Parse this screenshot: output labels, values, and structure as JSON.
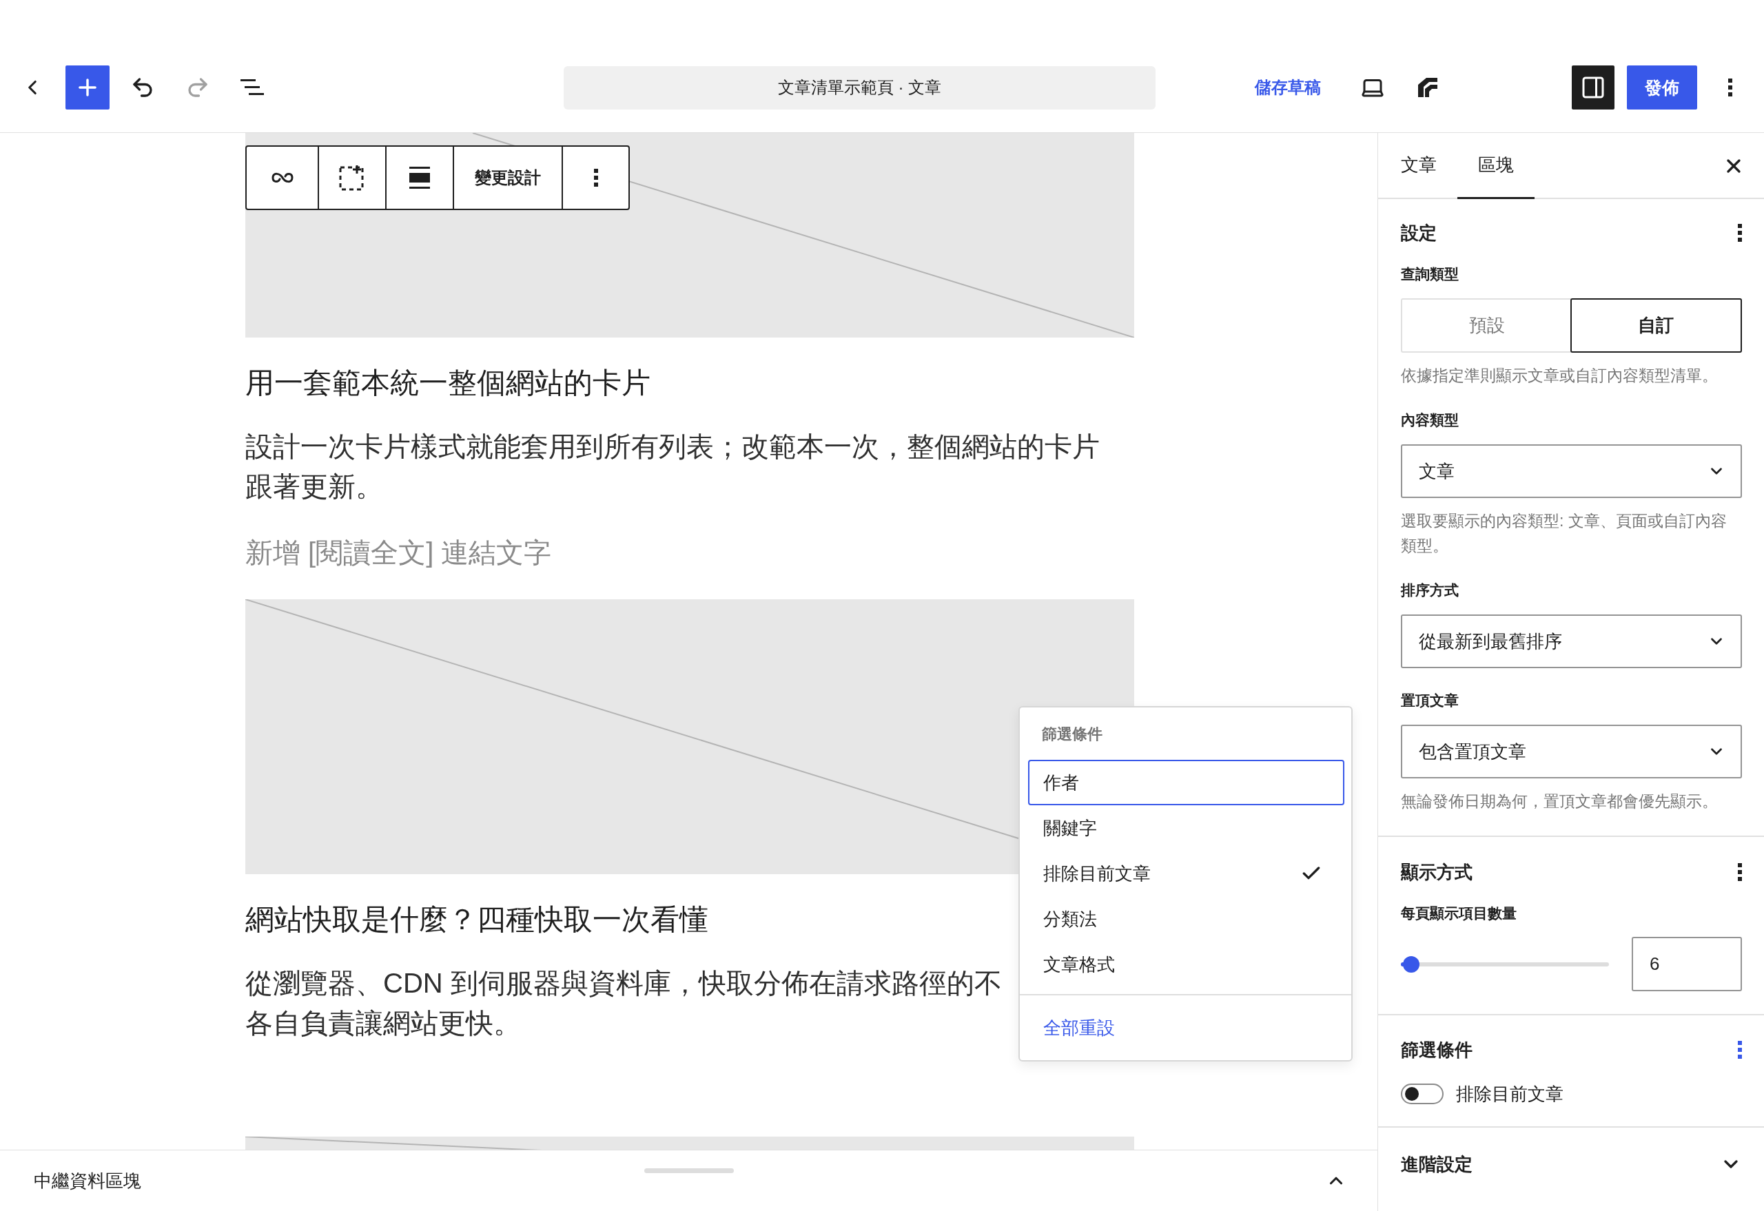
{
  "top_bar": {
    "title": "文章清單示範頁 · 文章",
    "undo": {
      "disabled": false
    },
    "redo": {
      "disabled": true
    },
    "save_draft": "儲存草稿",
    "sidebar_toggle": {
      "pressed": true
    },
    "publish": "發佈"
  },
  "block_toolbar": {
    "design_button": "變更設計"
  },
  "posts": [
    {
      "title": "用一套範本統一整個網站的卡片",
      "excerpt": "設計一次卡片樣式就能套用到所有列表；改範本一次，整個網站的卡片跟著更新。",
      "read_more": "新增 [閱讀全文] 連結文字"
    },
    {
      "title": "網站快取是什麼？四種快取一次看懂",
      "excerpt": "從瀏覽器、CDN 到伺服器與資料庫，快取分佈在請求路徑的不各自負責讓網站更快。"
    }
  ],
  "filter_menu": {
    "heading": "篩選條件",
    "items": [
      {
        "label": "作者",
        "focused": true,
        "checked": false
      },
      {
        "label": "關鍵字",
        "focused": false,
        "checked": false
      },
      {
        "label": "排除目前文章",
        "focused": false,
        "checked": true
      },
      {
        "label": "分類法",
        "focused": false,
        "checked": false
      },
      {
        "label": "文章格式",
        "focused": false,
        "checked": false
      }
    ],
    "reset": "全部重設"
  },
  "sidebar": {
    "tabs": [
      {
        "label": "文章",
        "selected": false
      },
      {
        "label": "區塊",
        "selected": true
      }
    ],
    "settings": {
      "title": "設定",
      "query_type": {
        "label": "查詢類型",
        "options": [
          {
            "label": "預設",
            "selected": false
          },
          {
            "label": "自訂",
            "selected": true
          }
        ],
        "help": "依據指定準則顯示文章或自訂內容類型清單。"
      },
      "fields": [
        {
          "label": "內容類型",
          "value": "文章",
          "help": "選取要顯示的內容類型: 文章、頁面或自訂內容類型。"
        },
        {
          "label": "排序方式",
          "value": "從最新到最舊排序"
        },
        {
          "label": "置頂文章",
          "value": "包含置頂文章",
          "help": "無論發佈日期為何，置頂文章都會優先顯示。"
        }
      ]
    },
    "display": {
      "title": "顯示方式",
      "items_per_page": {
        "label": "每頁顯示項目數量",
        "level": 0.05,
        "value": "6"
      }
    },
    "filters": {
      "title": "篩選條件",
      "menu_open": true,
      "toggles": [
        {
          "label": "排除目前文章",
          "on": false
        }
      ]
    },
    "advanced": {
      "title": "進階設定",
      "expanded": false
    }
  },
  "footer": {
    "breadcrumb": "中繼資料區塊"
  }
}
